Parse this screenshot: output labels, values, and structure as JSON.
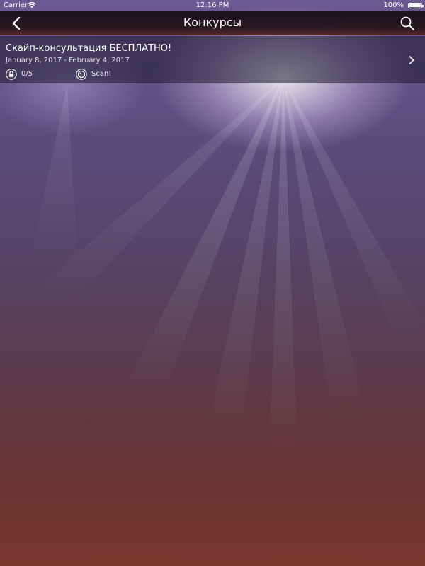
{
  "status_bar": {
    "carrier": "Carrier",
    "time": "12:16 PM",
    "battery": "100%"
  },
  "nav": {
    "title": "Конкурсы"
  },
  "contest": {
    "title": "Скайп-консультация БЕСПЛАТНО!",
    "dates": "January 8, 2017 - February 4, 2017",
    "progress": "0/5",
    "action": "Scan!"
  }
}
